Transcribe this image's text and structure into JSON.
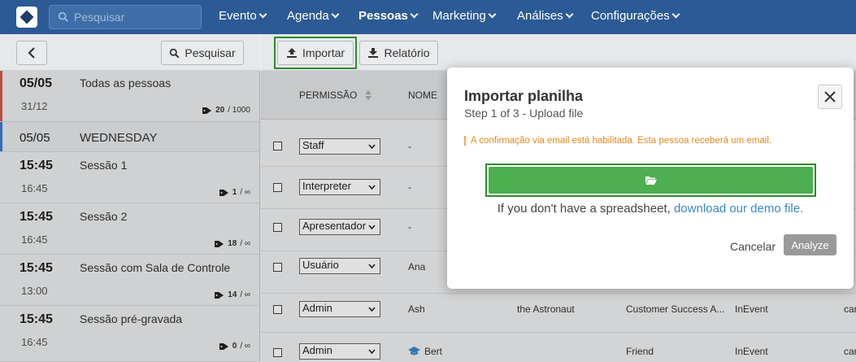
{
  "nav": {
    "search_placeholder": "Pesquisar",
    "items": [
      {
        "label": "Evento",
        "active": false
      },
      {
        "label": "Agenda",
        "active": false
      },
      {
        "label": "Pessoas",
        "active": true
      },
      {
        "label": "Marketing",
        "active": false
      },
      {
        "label": "Análises",
        "active": false
      },
      {
        "label": "Configurações",
        "active": false
      }
    ]
  },
  "left": {
    "search_button": "Pesquisar",
    "items": [
      {
        "t1": "05/05",
        "t2": "31/12",
        "title": "Todas as pessoas",
        "count": "20",
        "limit": "/ 1000"
      },
      {
        "t1": "05/05",
        "title": "WEDNESDAY"
      },
      {
        "t1": "15:45",
        "t2": "16:45",
        "title": "Sessão 1",
        "count": "1",
        "limit": "/ ∞"
      },
      {
        "t1": "15:45",
        "t2": "16:45",
        "title": "Sessão 2",
        "count": "18",
        "limit": "/ ∞"
      },
      {
        "t1": "15:45",
        "t2": "13:00",
        "title": "Sessão com Sala de Controle",
        "count": "14",
        "limit": "/ ∞"
      },
      {
        "t1": "15:45",
        "t2": "16:45",
        "title": "Sessão pré-gravada",
        "count": "0",
        "limit": "/ ∞"
      }
    ]
  },
  "toolbar": {
    "import_label": "Importar",
    "report_label": "Relatório"
  },
  "table": {
    "headers": {
      "permission": "PERMISSÃO",
      "name": "NOME"
    },
    "rows": [
      {
        "permission": "Staff",
        "name": "-",
        "c3": "",
        "c4": "",
        "c5": "",
        "c6": ""
      },
      {
        "permission": "Interpreter",
        "name": "-",
        "c3": "",
        "c4": "",
        "c5": "",
        "c6": ""
      },
      {
        "permission": "Apresentador",
        "name": "-",
        "c3": "",
        "c4": "",
        "c5": "",
        "c6": ""
      },
      {
        "permission": "Usuário",
        "name": "Ana",
        "c3": "",
        "c4": "",
        "c5": "",
        "c6": ""
      },
      {
        "permission": "Admin",
        "name": "Ash",
        "c3": "the Astronaut",
        "c4": "Customer Success A...",
        "c5": "InEvent",
        "c6": "car"
      },
      {
        "permission": "Admin",
        "name": "Bert",
        "c3": "",
        "c4": "Friend",
        "c5": "InEvent",
        "c6": "car"
      }
    ]
  },
  "modal": {
    "title": "Importar planilha",
    "subtitle": "Step 1 of 3 - Upload file",
    "notice": "A confirmação via email está habilitada. Esta pessoa receberá um email.",
    "hint_prefix": "If you don't have a spreadsheet,",
    "hint_link": "download our demo file.",
    "cancel_label": "Cancelar",
    "analyze_label": "Analyze"
  },
  "colors": {
    "nav_bg": "#2b5a94",
    "upload_green": "#4caf50",
    "highlight_green": "#2e8b2e",
    "notice_orange": "#e08a1e",
    "link_blue": "#3a87c8"
  }
}
